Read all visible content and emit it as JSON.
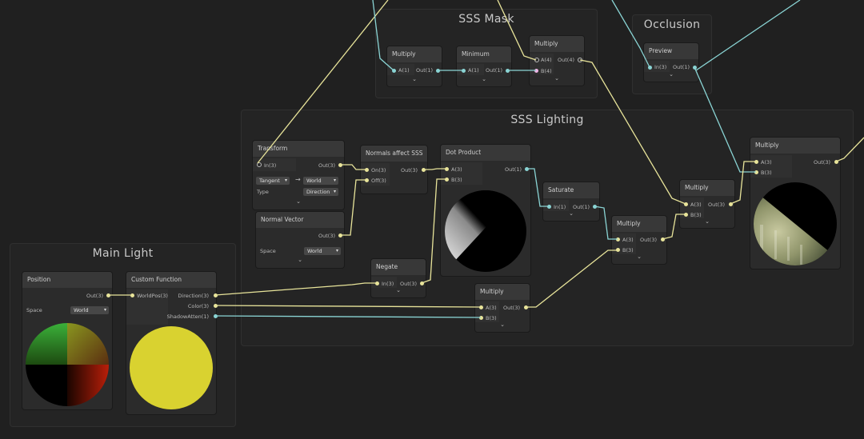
{
  "groups": {
    "sss_mask": "SSS Mask",
    "occlusion": "Occlusion",
    "sss_lighting": "SSS Lighting",
    "main_light": "Main Light"
  },
  "nodes": {
    "mask_multiply_1": {
      "title": "Multiply",
      "in_a": "A(1)",
      "out": "Out(1)"
    },
    "minimum": {
      "title": "Minimum",
      "in_a": "A(1)",
      "out": "Out(1)"
    },
    "mask_multiply_2": {
      "title": "Multiply",
      "in_a": "A(4)",
      "in_b": "B(4)",
      "out": "Out(4)"
    },
    "occ_preview": {
      "title": "Preview",
      "in": "In(3)",
      "out": "Out(1)"
    },
    "transform": {
      "title": "Transform",
      "in": "In(3)",
      "out": "Out(3)",
      "from": "Tangent",
      "arrow": "→",
      "to": "World",
      "type_label": "Type",
      "type_value": "Direction"
    },
    "normal_vector": {
      "title": "Normal Vector",
      "out": "Out(3)",
      "space_label": "Space",
      "space_value": "World"
    },
    "normals_affect_sss": {
      "title": "Normals affect SSS",
      "in_on": "On(3)",
      "in_off": "Off(3)",
      "out": "Out(3)"
    },
    "dot_product": {
      "title": "Dot Product",
      "in_a": "A(3)",
      "in_b": "B(3)",
      "out": "Out(1)"
    },
    "saturate": {
      "title": "Saturate",
      "in": "In(1)",
      "out": "Out(1)"
    },
    "negate": {
      "title": "Negate",
      "in": "In(3)",
      "out": "Out(3)"
    },
    "lighting_multiply_1": {
      "title": "Multiply",
      "in_a": "A(3)",
      "in_b": "B(3)",
      "out": "Out(3)"
    },
    "lighting_multiply_2": {
      "title": "Multiply",
      "in_a": "A(3)",
      "in_b": "B(3)",
      "out": "Out(3)"
    },
    "lighting_multiply_3": {
      "title": "Multiply",
      "in_a": "A(3)",
      "in_b": "B(3)",
      "out": "Out(3)"
    },
    "final_multiply": {
      "title": "Multiply",
      "in_a": "A(3)",
      "in_b": "B(3)",
      "out": "Out(3)"
    },
    "position": {
      "title": "Position",
      "out": "Out(3)",
      "space_label": "Space",
      "space_value": "World"
    },
    "custom_function": {
      "title": "Custom Function",
      "in": "WorldPos(3)",
      "out_dir": "Direction(3)",
      "out_color": "Color(3)",
      "out_shadow": "ShadowAtten(1)"
    }
  },
  "icons": {
    "expand": "chevron-down-icon",
    "dropdown": "caret-down-icon"
  },
  "colors": {
    "background": "#202020",
    "group": "#242424",
    "node": "#2b2b2b",
    "node_header": "#383838",
    "vector1_port": "#8ad4d4",
    "vector3_port": "#e8e49a",
    "vector4_port": "#f0b5e6"
  }
}
